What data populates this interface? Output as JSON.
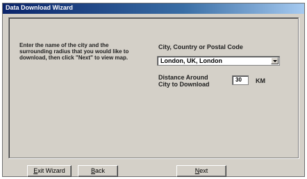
{
  "window": {
    "title": "Data Download Wizard"
  },
  "instructions": "Enter the name of the city and the surrounding radius that you would like to download, then click \"Next\" to view map.",
  "city": {
    "label": "City, Country or Postal Code",
    "selected_value": "London, UK, London"
  },
  "distance": {
    "label": "Distance Around City to Download",
    "value": "30",
    "unit": "KM"
  },
  "buttons": {
    "exit_first": "E",
    "exit_rest": "xit Wizard",
    "back_first": "B",
    "back_rest": "ack",
    "next_first": "N",
    "next_rest": "ext"
  }
}
